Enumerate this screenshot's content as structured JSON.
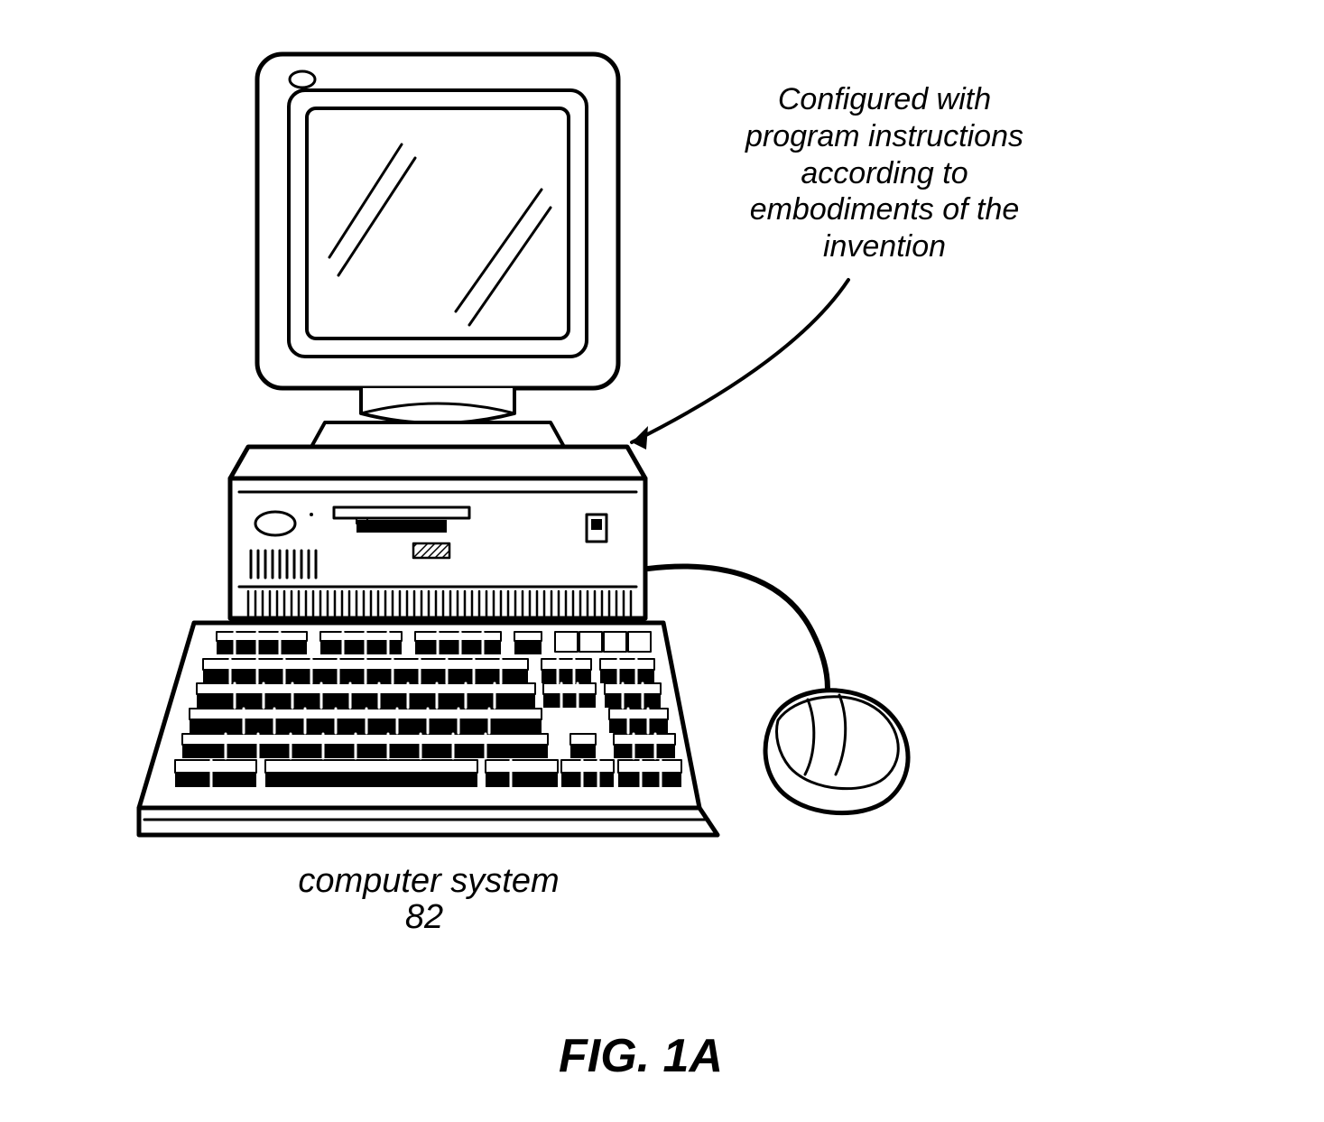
{
  "callout": {
    "line1": "Configured with",
    "line2": "program instructions",
    "line3": "according to",
    "line4": "embodiments of the",
    "line5": "invention"
  },
  "label": {
    "name": "computer system",
    "number": "82"
  },
  "figure": "FIG. 1A"
}
